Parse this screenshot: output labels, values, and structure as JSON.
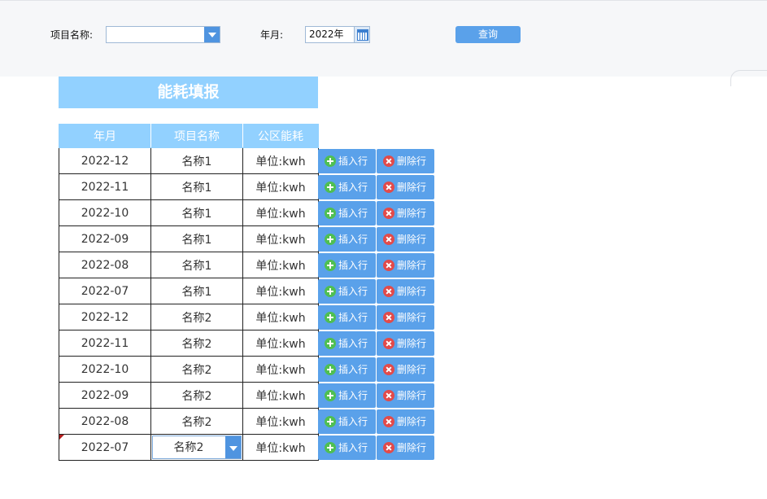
{
  "filters": {
    "project_label": "项目名称:",
    "project_value": "",
    "month_label": "年月:",
    "month_value": "2022年",
    "query_label": "查询"
  },
  "title": "能耗填报",
  "columns": [
    "年月",
    "项目名称",
    "公区能耗"
  ],
  "rows": [
    {
      "month": "2022-12",
      "name": "名称1",
      "energy_placeholder": "单位:kwh"
    },
    {
      "month": "2022-11",
      "name": "名称1",
      "energy_placeholder": "单位:kwh"
    },
    {
      "month": "2022-10",
      "name": "名称1",
      "energy_placeholder": "单位:kwh"
    },
    {
      "month": "2022-09",
      "name": "名称1",
      "energy_placeholder": "单位:kwh"
    },
    {
      "month": "2022-08",
      "name": "名称1",
      "energy_placeholder": "单位:kwh"
    },
    {
      "month": "2022-07",
      "name": "名称1",
      "energy_placeholder": "单位:kwh"
    },
    {
      "month": "2022-12",
      "name": "名称2",
      "energy_placeholder": "单位:kwh"
    },
    {
      "month": "2022-11",
      "name": "名称2",
      "energy_placeholder": "单位:kwh"
    },
    {
      "month": "2022-10",
      "name": "名称2",
      "energy_placeholder": "单位:kwh"
    },
    {
      "month": "2022-09",
      "name": "名称2",
      "energy_placeholder": "单位:kwh"
    },
    {
      "month": "2022-08",
      "name": "名称2",
      "energy_placeholder": "单位:kwh"
    },
    {
      "month": "2022-07",
      "name": "名称2",
      "energy_placeholder": "单位:kwh"
    }
  ],
  "actions": {
    "insert_label": "插入行",
    "delete_label": "删除行"
  },
  "colors": {
    "accent": "#5aa1ea",
    "header": "#92d1ff",
    "insert_icon": "#4fbf52",
    "delete_icon": "#e24a4a"
  }
}
